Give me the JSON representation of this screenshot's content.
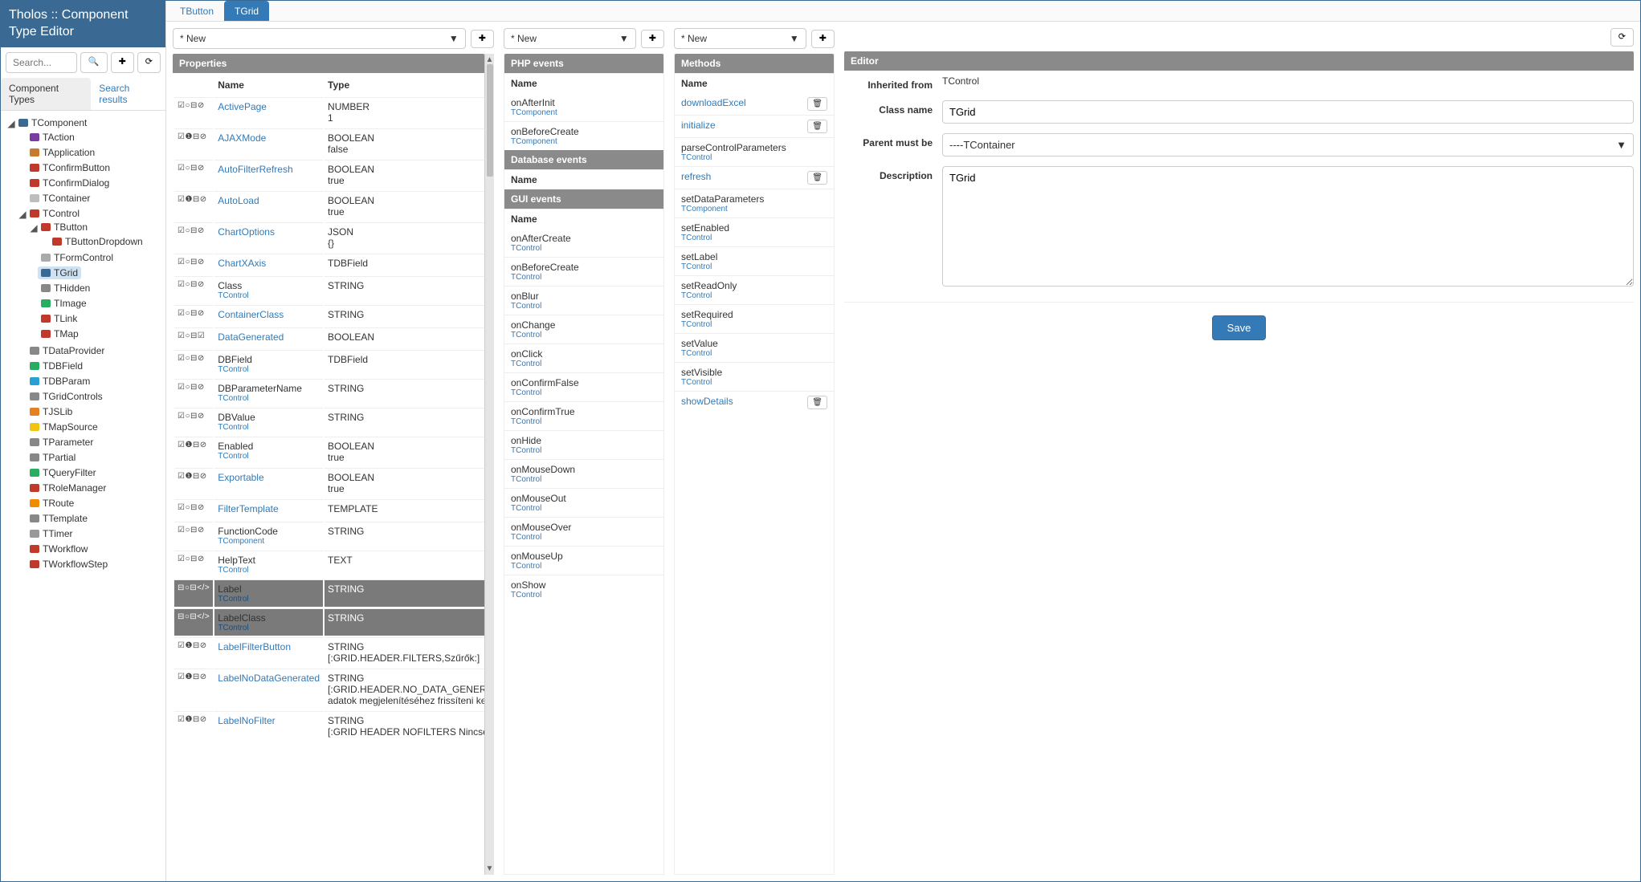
{
  "app_title": "Tholos :: Component Type Editor",
  "search": {
    "placeholder": "Search..."
  },
  "icons": {
    "search": "🔍",
    "add": "✚",
    "refresh": "⟳",
    "trash": "🗑",
    "gear": "⚙",
    "caret": "▼",
    "up": "▲",
    "down": "▼"
  },
  "sidebar_tabs": {
    "a": "Component Types",
    "b": "Search results"
  },
  "tree": [
    {
      "tog": "◢",
      "name": "TComponent",
      "color": "#3a6a93",
      "children": [
        {
          "name": "TAction",
          "color": "#7a3aa0"
        },
        {
          "name": "TApplication",
          "color": "#c97a2a"
        },
        {
          "name": "TConfirmButton",
          "color": "#c0392b"
        },
        {
          "name": "TConfirmDialog",
          "color": "#c0392b"
        },
        {
          "name": "TContainer",
          "color": "#bdbdbd"
        },
        {
          "tog": "◢",
          "name": "TControl",
          "color": "#c0392b",
          "children": [
            {
              "tog": "◢",
              "name": "TButton",
              "color": "#c0392b",
              "children": [
                {
                  "name": "TButtonDropdown",
                  "color": "#c0392b"
                }
              ]
            },
            {
              "name": "TFormControl",
              "color": "#aaa"
            },
            {
              "name": "TGrid",
              "color": "#3a6a93",
              "selected": true
            },
            {
              "name": "THidden",
              "color": "#888"
            },
            {
              "name": "TImage",
              "color": "#27ae60"
            },
            {
              "name": "TLink",
              "color": "#c0392b"
            },
            {
              "name": "TMap",
              "color": "#c0392b"
            }
          ]
        },
        {
          "name": "TDataProvider",
          "color": "#888"
        },
        {
          "name": "TDBField",
          "color": "#27ae60"
        },
        {
          "name": "TDBParam",
          "color": "#2a9fd6"
        },
        {
          "name": "TGridControls",
          "color": "#888"
        },
        {
          "name": "TJSLib",
          "color": "#e67e22"
        },
        {
          "name": "TMapSource",
          "color": "#f1c40f"
        },
        {
          "name": "TParameter",
          "color": "#888"
        },
        {
          "name": "TPartial",
          "color": "#888"
        },
        {
          "name": "TQueryFilter",
          "color": "#27ae60"
        },
        {
          "name": "TRoleManager",
          "color": "#c0392b"
        },
        {
          "name": "TRoute",
          "color": "#f08c00"
        },
        {
          "name": "TTemplate",
          "color": "#888"
        },
        {
          "name": "TTimer",
          "color": "#999"
        },
        {
          "name": "TWorkflow",
          "color": "#c0392b"
        },
        {
          "name": "TWorkflowStep",
          "color": "#c0392b"
        }
      ]
    }
  ],
  "tabs": [
    {
      "label": "TButton",
      "active": false
    },
    {
      "label": "TGrid",
      "active": true
    }
  ],
  "new_label": "* New",
  "panels": {
    "properties": "Properties",
    "php": "PHP events",
    "db": "Database events",
    "gui": "GUI events",
    "methods": "Methods",
    "editor": "Editor"
  },
  "prop_headers": {
    "name": "Name",
    "type": "Type"
  },
  "name_header": "Name",
  "properties": [
    {
      "ic": "☑○⊟⊘",
      "name": "ActivePage",
      "link": true,
      "type": "NUMBER",
      "val": "1",
      "act": [
        "trash",
        "gear"
      ]
    },
    {
      "ic": "☑❶⊟⊘",
      "name": "AJAXMode",
      "link": true,
      "type": "BOOLEAN",
      "val": "false",
      "act": [
        "trash",
        "gear"
      ]
    },
    {
      "ic": "☑○⊟⊘",
      "name": "AutoFilterRefresh",
      "link": true,
      "type": "BOOLEAN",
      "val": "true",
      "act": [
        "trash",
        "gear"
      ]
    },
    {
      "ic": "☑❶⊟⊘",
      "name": "AutoLoad",
      "link": true,
      "type": "BOOLEAN",
      "val": "true",
      "act": [
        "trash",
        "gear"
      ]
    },
    {
      "ic": "☑○⊟⊘",
      "name": "ChartOptions",
      "link": true,
      "type": "JSON",
      "val": "{}",
      "act": [
        "trash",
        "gear"
      ]
    },
    {
      "ic": "☑○⊟⊘",
      "name": "ChartXAxis",
      "link": true,
      "type": "TDBField",
      "act": [
        "trash",
        "gear"
      ]
    },
    {
      "ic": "☑○⊟⊘",
      "name": "Class",
      "link": false,
      "origin": "TControl",
      "type": "STRING",
      "act": [
        "gear"
      ]
    },
    {
      "ic": "☑○⊟⊘",
      "name": "ContainerClass",
      "link": true,
      "type": "STRING",
      "act": [
        "trash",
        "gear"
      ]
    },
    {
      "ic": "☑○⊟☑",
      "name": "DataGenerated",
      "link": true,
      "type": "BOOLEAN",
      "act": [
        "trash",
        "gear"
      ]
    },
    {
      "ic": "☑○⊟⊘",
      "name": "DBField",
      "link": false,
      "origin": "TControl",
      "type": "TDBField",
      "act": [
        "gear"
      ]
    },
    {
      "ic": "☑○⊟⊘",
      "name": "DBParameterName",
      "link": false,
      "origin": "TControl",
      "type": "STRING",
      "act": [
        "gear"
      ]
    },
    {
      "ic": "☑○⊟⊘",
      "name": "DBValue",
      "link": false,
      "origin": "TControl",
      "type": "STRING",
      "act": [
        "gear"
      ]
    },
    {
      "ic": "☑❶⊟⊘",
      "name": "Enabled",
      "link": false,
      "origin": "TControl",
      "type": "BOOLEAN",
      "val": "true",
      "act": [
        "gear"
      ]
    },
    {
      "ic": "☑❶⊟⊘",
      "name": "Exportable",
      "link": true,
      "type": "BOOLEAN",
      "val": "true",
      "act": [
        "trash",
        "gear"
      ]
    },
    {
      "ic": "☑○⊟⊘",
      "name": "FilterTemplate",
      "link": true,
      "type": "TEMPLATE",
      "act": [
        "trash",
        "gear"
      ]
    },
    {
      "ic": "☑○⊟⊘",
      "name": "FunctionCode",
      "link": false,
      "origin": "TComponent",
      "type": "STRING",
      "act": [
        "gear"
      ]
    },
    {
      "ic": "☑○⊟⊘",
      "name": "HelpText",
      "link": false,
      "origin": "TControl",
      "type": "TEXT",
      "act": [
        "gear"
      ]
    },
    {
      "ic": "⊟○⊟</>",
      "name": "Label",
      "link": false,
      "origin": "TControl",
      "type": "STRING",
      "act": [
        "gear"
      ],
      "shaded": true
    },
    {
      "ic": "⊟○⊟</>",
      "name": "LabelClass",
      "link": false,
      "origin": "TControl",
      "type": "STRING",
      "act": [
        "gear"
      ],
      "shaded": true
    },
    {
      "ic": "☑❶⊟⊘",
      "name": "LabelFilterButton",
      "link": true,
      "type": "STRING",
      "val": "[:GRID.HEADER.FILTERS,Szűrők:]",
      "act": [
        "trash",
        "gear"
      ]
    },
    {
      "ic": "☑❶⊟⊘",
      "name": "LabelNoDataGenerated",
      "link": true,
      "type": "STRING",
      "val": "[:GRID.HEADER.NO_DATA_GENERATED,Az adatok megjelenítéséhez frissíteni kell!:]",
      "act": [
        "trash",
        "gear"
      ]
    },
    {
      "ic": "☑❶⊟⊘",
      "name": "LabelNoFilter",
      "link": true,
      "type": "STRING",
      "val": "[:GRID HEADER NOFILTERS Nincsenek",
      "act": [
        "trash",
        "gear"
      ]
    }
  ],
  "php_events": [
    {
      "name": "onAfterInit",
      "origin": "TComponent"
    },
    {
      "name": "onBeforeCreate",
      "origin": "TComponent"
    }
  ],
  "gui_events": [
    {
      "name": "onAfterCreate",
      "origin": "TControl"
    },
    {
      "name": "onBeforeCreate",
      "origin": "TControl"
    },
    {
      "name": "onBlur",
      "origin": "TControl"
    },
    {
      "name": "onChange",
      "origin": "TControl"
    },
    {
      "name": "onClick",
      "origin": "TControl"
    },
    {
      "name": "onConfirmFalse",
      "origin": "TControl"
    },
    {
      "name": "onConfirmTrue",
      "origin": "TControl"
    },
    {
      "name": "onHide",
      "origin": "TControl"
    },
    {
      "name": "onMouseDown",
      "origin": "TControl"
    },
    {
      "name": "onMouseOut",
      "origin": "TControl"
    },
    {
      "name": "onMouseOver",
      "origin": "TControl"
    },
    {
      "name": "onMouseUp",
      "origin": "TControl"
    },
    {
      "name": "onShow",
      "origin": "TControl"
    }
  ],
  "methods": [
    {
      "name": "downloadExcel",
      "link": true,
      "del": true
    },
    {
      "name": "initialize",
      "link": true,
      "del": true
    },
    {
      "name": "parseControlParameters",
      "origin": "TControl"
    },
    {
      "name": "refresh",
      "link": true,
      "del": true
    },
    {
      "name": "setDataParameters",
      "origin": "TComponent"
    },
    {
      "name": "setEnabled",
      "origin": "TControl"
    },
    {
      "name": "setLabel",
      "origin": "TControl"
    },
    {
      "name": "setReadOnly",
      "origin": "TControl"
    },
    {
      "name": "setRequired",
      "origin": "TControl"
    },
    {
      "name": "setValue",
      "origin": "TControl"
    },
    {
      "name": "setVisible",
      "origin": "TControl"
    },
    {
      "name": "showDetails",
      "link": true,
      "del": true
    }
  ],
  "editor": {
    "labels": {
      "inherited": "Inherited from",
      "classname": "Class name",
      "parent": "Parent must be",
      "desc": "Description"
    },
    "inherited_from": "TControl",
    "class_name": "TGrid",
    "parent_must_be": "----TContainer",
    "description": "TGrid",
    "save": "Save"
  }
}
